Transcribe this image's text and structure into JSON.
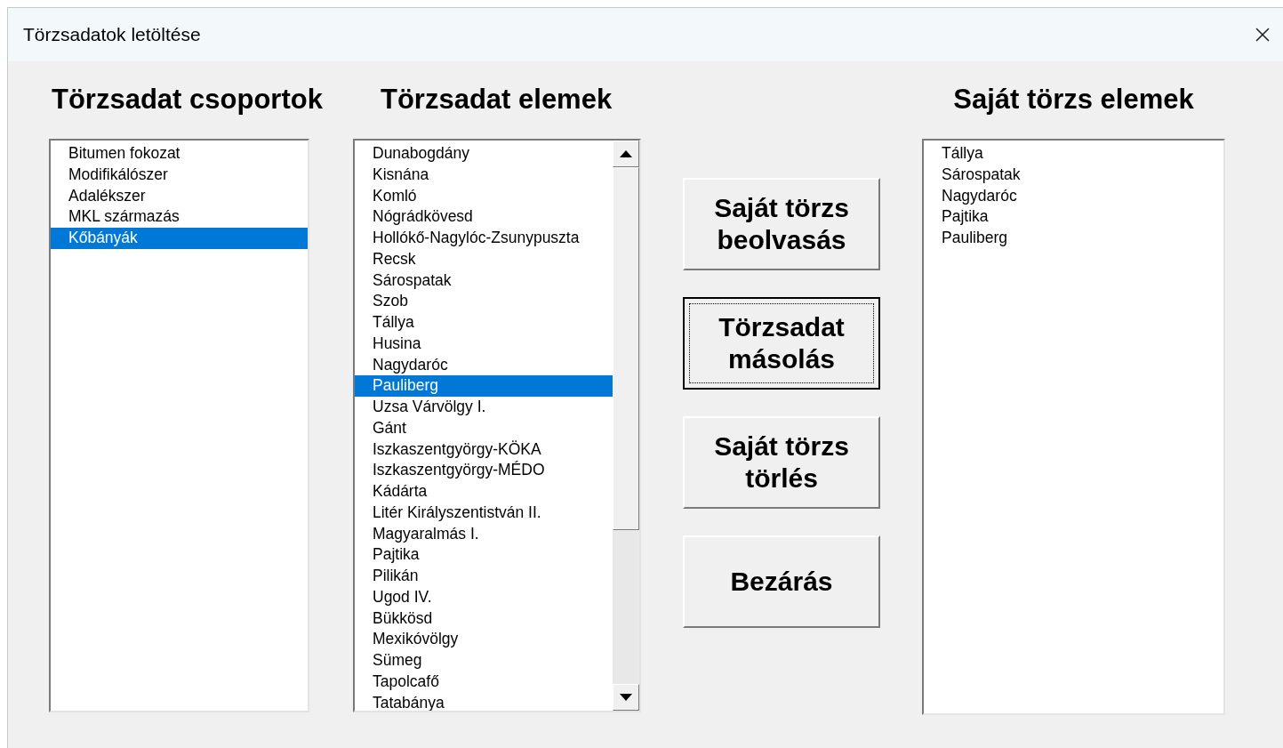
{
  "window": {
    "title": "Törzsadatok letöltése"
  },
  "groups": {
    "heading": "Törzsadat csoportok",
    "items": [
      {
        "label": "Bitumen fokozat",
        "selected": false
      },
      {
        "label": "Modifikálószer",
        "selected": false
      },
      {
        "label": "Adalékszer",
        "selected": false
      },
      {
        "label": "MKL származás",
        "selected": false
      },
      {
        "label": "Kőbányák",
        "selected": true
      }
    ]
  },
  "elements": {
    "heading": "Törzsadat elemek",
    "items": [
      {
        "label": "Dunabogdány",
        "selected": false
      },
      {
        "label": "Kisnána",
        "selected": false
      },
      {
        "label": "Komló",
        "selected": false
      },
      {
        "label": "Nógrádkövesd",
        "selected": false
      },
      {
        "label": "Hollókő-Nagylóc-Zsunypuszta",
        "selected": false
      },
      {
        "label": "Recsk",
        "selected": false
      },
      {
        "label": "Sárospatak",
        "selected": false
      },
      {
        "label": "Szob",
        "selected": false
      },
      {
        "label": "Tállya",
        "selected": false
      },
      {
        "label": "Husina",
        "selected": false
      },
      {
        "label": "Nagydaróc",
        "selected": false
      },
      {
        "label": "Pauliberg",
        "selected": true
      },
      {
        "label": "Uzsa Várvölgy I.",
        "selected": false
      },
      {
        "label": "Gánt",
        "selected": false
      },
      {
        "label": "Iszkaszentgyörgy-KÖKA",
        "selected": false
      },
      {
        "label": "Iszkaszentgyörgy-MÉDO",
        "selected": false
      },
      {
        "label": "Kádárta",
        "selected": false
      },
      {
        "label": "Litér Királyszentistván II.",
        "selected": false
      },
      {
        "label": "Magyaralmás I.",
        "selected": false
      },
      {
        "label": "Pajtika",
        "selected": false
      },
      {
        "label": "Pilikán",
        "selected": false
      },
      {
        "label": "Ugod IV.",
        "selected": false
      },
      {
        "label": "Bükkösd",
        "selected": false
      },
      {
        "label": "Mexikóvölgy",
        "selected": false
      },
      {
        "label": "Sümeg",
        "selected": false
      },
      {
        "label": "Tapolcafő",
        "selected": false
      },
      {
        "label": "Tatabánya",
        "selected": false
      }
    ]
  },
  "buttons": [
    {
      "label": "Saját törzs beolvasás",
      "focused": false
    },
    {
      "label": "Törzsadat másolás",
      "focused": true
    },
    {
      "label": "Saját törzs törlés",
      "focused": false
    },
    {
      "label": "Bezárás",
      "focused": false
    }
  ],
  "own": {
    "heading": "Saját törzs elemek",
    "items": [
      {
        "label": "Tállya",
        "selected": false
      },
      {
        "label": "Sárospatak",
        "selected": false
      },
      {
        "label": "Nagydaróc",
        "selected": false
      },
      {
        "label": "Pajtika",
        "selected": false
      },
      {
        "label": "Pauliberg",
        "selected": false
      }
    ]
  }
}
